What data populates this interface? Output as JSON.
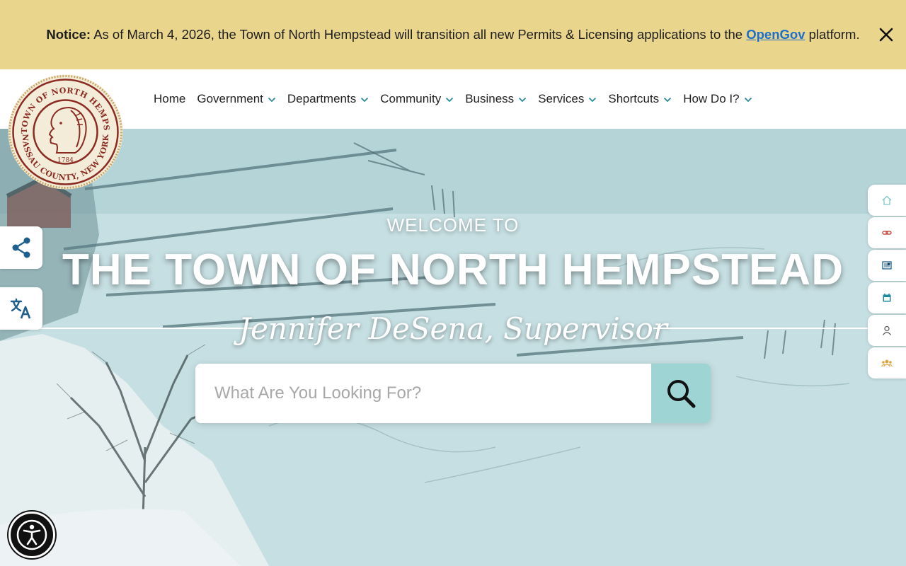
{
  "notice": {
    "label": "Notice:",
    "text_before": " As of March 4, 2026, the Town of North Hempstead will transition all new Permits & Licensing applications to the ",
    "link": "OpenGov",
    "text_after": " platform."
  },
  "seal": {
    "top_text": "THE TOWN OF NORTH HEMPSTEAD",
    "bottom_text": "NASSAU COUNTY, NEW YORK",
    "year": "1784"
  },
  "nav": {
    "items": [
      {
        "label": "Home",
        "dropdown": false
      },
      {
        "label": "Government",
        "dropdown": true
      },
      {
        "label": "Departments",
        "dropdown": true
      },
      {
        "label": "Community",
        "dropdown": true
      },
      {
        "label": "Business",
        "dropdown": true
      },
      {
        "label": "Services",
        "dropdown": true
      },
      {
        "label": "Shortcuts",
        "dropdown": true
      },
      {
        "label": "How Do I?",
        "dropdown": true
      }
    ]
  },
  "hero": {
    "welcome": "WELCOME TO",
    "title": "THE TOWN OF NORTH HEMPSTEAD",
    "supervisor": "Jennifer DeSena, Supervisor"
  },
  "search": {
    "placeholder": "What Are You Looking For?"
  },
  "quick_links": [
    "home-icon",
    "link-icon",
    "news-icon",
    "calendar-icon",
    "user-icon",
    "community-icon"
  ],
  "colors": {
    "notice_bg": "#ead58c",
    "link": "#1a6fcf",
    "search_button": "#9fd4d4",
    "seal": "#8b2b22",
    "nav_chevron": "#2a8a9e"
  }
}
